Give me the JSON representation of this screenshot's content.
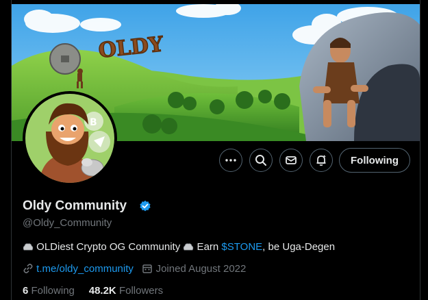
{
  "banner": {
    "sign_text": "OLDY"
  },
  "profile": {
    "display_name": "Oldy Community",
    "handle": "@Oldy_Community",
    "bio": {
      "part1": " OLDiest Crypto OG Community ",
      "part2": " Earn ",
      "cashtag": "$STONE",
      "part3": ", be Uga-Degen"
    },
    "link": "t.me/oldy_community",
    "joined": "Joined August 2022",
    "following_count": "6",
    "following_label": "Following",
    "followers_count": "48.2K",
    "followers_label": "Followers"
  },
  "actions": {
    "more_icon": "more-horizontal-icon",
    "search_icon": "search-icon",
    "message_icon": "envelope-icon",
    "notify_icon": "bell-icon",
    "follow_label": "Following"
  },
  "colors": {
    "accent": "#1d9bf0",
    "background": "#000000",
    "muted_text": "#71767b"
  }
}
